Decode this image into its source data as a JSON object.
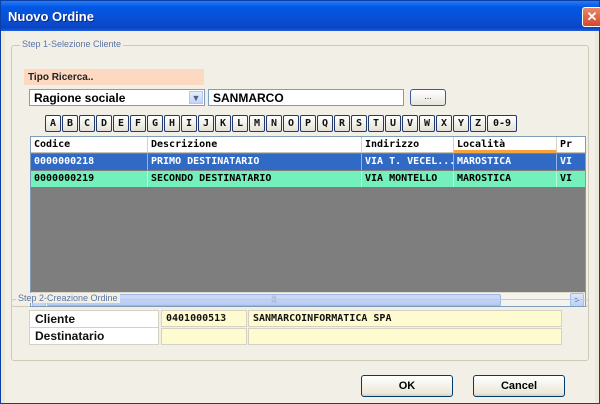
{
  "window": {
    "title": "Nuovo Ordine",
    "close_glyph": "✕",
    "close_icon": "close-icon"
  },
  "step1": {
    "legend": "Step 1-Selezione Cliente",
    "tipo_ricerca_label": "Tipo Ricerca..",
    "search_type": {
      "selected": "Ragione sociale"
    },
    "search_value": "SANMARCO",
    "browse_label": "...",
    "letters": [
      "A",
      "B",
      "C",
      "D",
      "E",
      "F",
      "G",
      "H",
      "I",
      "J",
      "K",
      "L",
      "M",
      "N",
      "O",
      "P",
      "Q",
      "R",
      "S",
      "T",
      "U",
      "V",
      "W",
      "X",
      "Y",
      "Z",
      "0-9"
    ],
    "grid": {
      "columns": [
        "Codice",
        "Descrizione",
        "Indirizzo",
        "Località",
        "Pr"
      ],
      "sorted_column": "Località",
      "rows": [
        {
          "codice": "0000000218",
          "descrizione": "PRIMO DESTINATARIO",
          "indirizzo": "VIA T. VECEL...",
          "localita": "MAROSTICA",
          "pr": "VI",
          "state": "selected"
        },
        {
          "codice": "0000000219",
          "descrizione": "SECONDO DESTINATARIO",
          "indirizzo": "VIA MONTELLO",
          "localita": "MAROSTICA",
          "pr": "VI",
          "state": "highlighted"
        }
      ],
      "scroll_left": "<",
      "scroll_right": ">",
      "scroll_grip": "|||"
    }
  },
  "step2": {
    "legend": "Step 2-Creazione Ordine",
    "cliente_label": "Cliente",
    "cliente_code": "0401000513",
    "cliente_name": "SANMARCOINFORMATICA SPA",
    "destinatario_label": "Destinatario",
    "destinatario_code": "",
    "destinatario_name": ""
  },
  "buttons": {
    "ok": "OK",
    "cancel": "Cancel"
  },
  "colors": {
    "titlebar": "#0a4fd3",
    "selected_row": "#316ac5",
    "highlight_row": "#74f0bd",
    "tipo_label_bg": "#fcd9c0",
    "field_bg": "#fffbd1"
  }
}
